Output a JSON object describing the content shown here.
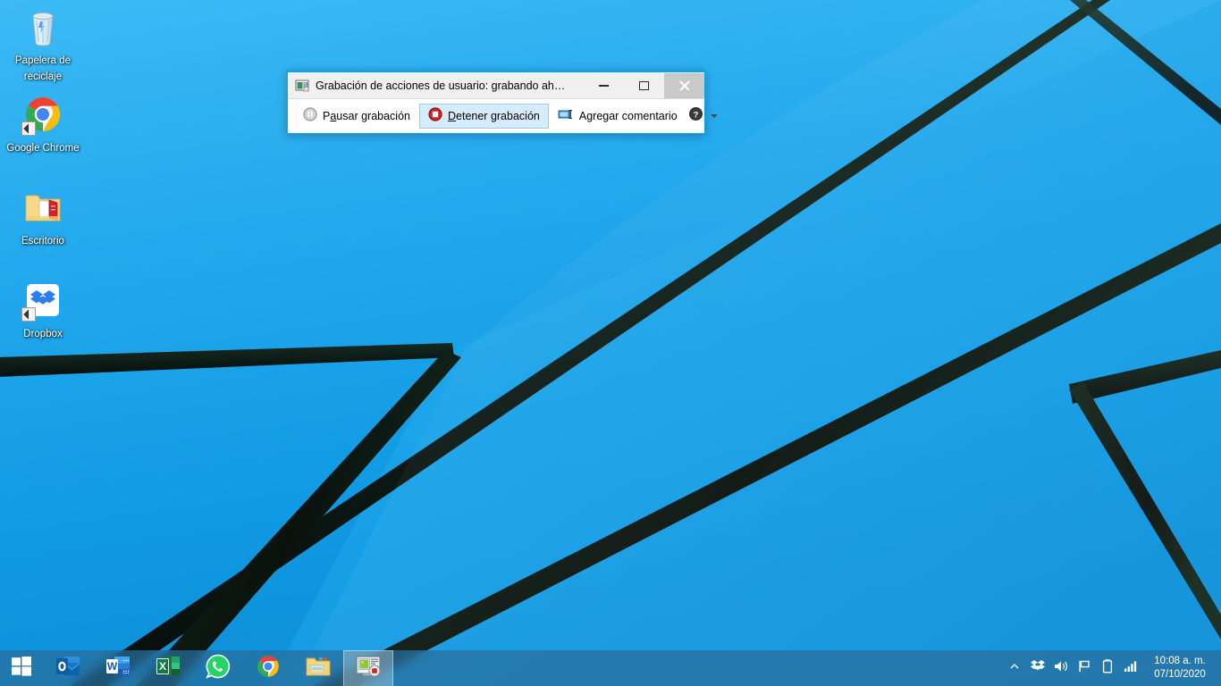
{
  "desktop": {
    "icons": [
      {
        "name": "recycle-bin",
        "label": "Papelera de reciclaje"
      },
      {
        "name": "google-chrome",
        "label": "Google Chrome"
      },
      {
        "name": "escritorio",
        "label": "Escritorio"
      },
      {
        "name": "dropbox",
        "label": "Dropbox"
      }
    ],
    "wallpaper_colors": {
      "sky": "#1ba1e2",
      "sky_light": "#2fb5f0",
      "beam": "#13251b",
      "beam_dark": "#0b1410"
    }
  },
  "window": {
    "title": "Grabación de acciones de usuario: grabando ah…",
    "title_icon": "recorder-icon",
    "accent_color": "#0fa4e8",
    "controls": {
      "minimize_label": "Minimizar",
      "maximize_label": "Maximizar",
      "close_label": "Cerrar"
    },
    "toolbar": {
      "pause": {
        "label_pre": "P",
        "label_accel": "a",
        "label_post": "usar grabación",
        "full": "Pausar grabación",
        "icon": "pause-icon"
      },
      "stop": {
        "label_pre": "",
        "label_accel": "D",
        "label_post": "etener grabación",
        "full": "Detener grabación",
        "icon": "stop-record-icon",
        "active": true
      },
      "comment": {
        "label_pre": "A",
        "label_accel": "g",
        "label_post": "regar comentario",
        "full": "Agregar comentario",
        "icon": "add-comment-icon"
      },
      "help": {
        "label": "Ayuda",
        "icon": "help-icon"
      },
      "help_caret": {
        "label": "Más opciones de ayuda",
        "icon": "chevron-down-icon"
      }
    }
  },
  "taskbar": {
    "start": {
      "name": "start-button",
      "label": "Inicio",
      "icon": "windows-logo-icon"
    },
    "apps": [
      {
        "name": "taskbar-outlook",
        "label": "Outlook",
        "icon": "outlook-icon",
        "running": false
      },
      {
        "name": "taskbar-word",
        "label": "Word",
        "icon": "word-icon",
        "running": false
      },
      {
        "name": "taskbar-excel",
        "label": "Excel",
        "icon": "excel-icon",
        "running": false
      },
      {
        "name": "taskbar-whatsapp",
        "label": "WhatsApp",
        "icon": "whatsapp-icon",
        "running": false
      },
      {
        "name": "taskbar-chrome",
        "label": "Google Chrome",
        "icon": "chrome-icon",
        "running": false
      },
      {
        "name": "taskbar-explorer",
        "label": "Explorador de archivos",
        "icon": "folder-icon",
        "running": false
      },
      {
        "name": "taskbar-psr",
        "label": "Grabación de acciones de usuario",
        "icon": "recorder-icon",
        "running": true
      }
    ],
    "tray": [
      {
        "name": "show-hidden-icons",
        "label": "Mostrar iconos ocultos",
        "icon": "chevron-up-icon"
      },
      {
        "name": "tray-dropbox",
        "label": "Dropbox",
        "icon": "dropbox-icon"
      },
      {
        "name": "tray-volume",
        "label": "Volumen",
        "icon": "speaker-icon"
      },
      {
        "name": "tray-action-center",
        "label": "Centro de actividades",
        "icon": "flag-icon"
      },
      {
        "name": "tray-battery",
        "label": "Batería",
        "icon": "battery-icon"
      },
      {
        "name": "tray-network",
        "label": "Red",
        "icon": "signal-bars-icon"
      }
    ],
    "clock": {
      "time": "10:08 a. m.",
      "date": "07/10/2020"
    }
  }
}
